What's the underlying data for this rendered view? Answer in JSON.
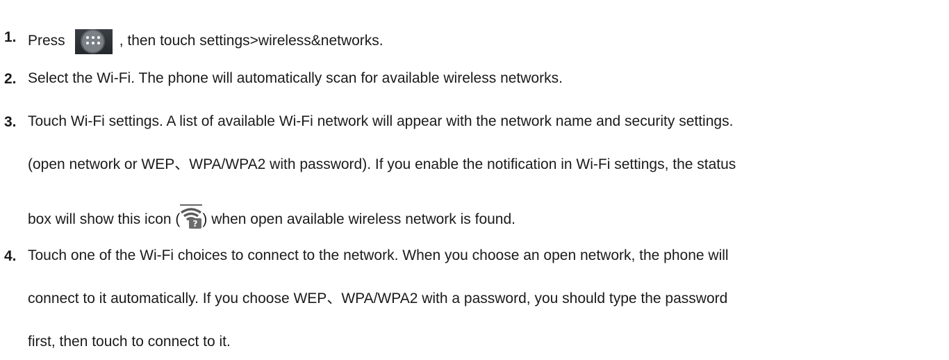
{
  "steps": [
    {
      "number": "1.",
      "text_before_icon": "Press",
      "icon": "apps-launcher-icon",
      "text_after_icon": ",  then touch settings>wireless&networks."
    },
    {
      "number": "2.",
      "text": "Select the Wi-Fi. The phone will automatically scan for available wireless networks."
    },
    {
      "number": "3.",
      "line1": "Touch Wi-Fi settings. A list of available Wi-Fi network will appear with the network name and security settings.",
      "line2": "(open network or WEP、WPA/WPA2 with password). If you enable the notification in Wi-Fi settings, the status",
      "line3_before_icon": "box will show this icon (",
      "icon": "wifi-open-network-icon",
      "line3_after_icon": ") when open available wireless network is found."
    },
    {
      "number": "4.",
      "line1": "Touch one of the Wi-Fi choices to connect to the network. When you choose an open network, the phone will",
      "line2": "connect to it automatically. If you choose WEP、WPA/WPA2 with a password, you should type the password",
      "line3": "first, then touch to connect to it."
    }
  ]
}
